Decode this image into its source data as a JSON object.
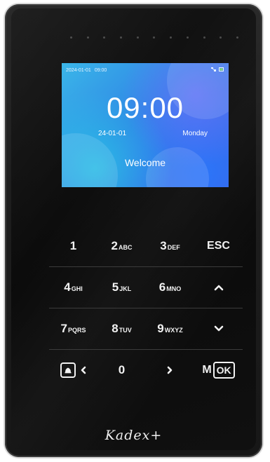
{
  "screen": {
    "status_date": "2024-01-01",
    "status_time": "09:00",
    "status_icons": [
      "network-icon",
      "battery-icon"
    ],
    "clock": "09:00",
    "date_short": "24-01-01",
    "weekday": "Monday",
    "welcome": "Welcome"
  },
  "keypad": {
    "row1": [
      {
        "digit": "1",
        "letters": ""
      },
      {
        "digit": "2",
        "letters": "ABC"
      },
      {
        "digit": "3",
        "letters": "DEF"
      },
      {
        "text": "ESC"
      }
    ],
    "row2": [
      {
        "digit": "4",
        "letters": "GHI"
      },
      {
        "digit": "5",
        "letters": "JKL"
      },
      {
        "digit": "6",
        "letters": "MNO"
      },
      {
        "icon": "chevron-up-icon"
      }
    ],
    "row3": [
      {
        "digit": "7",
        "letters": "PQRS"
      },
      {
        "digit": "8",
        "letters": "TUV"
      },
      {
        "digit": "9",
        "letters": "WXYZ"
      },
      {
        "icon": "chevron-down-icon"
      }
    ],
    "row4": {
      "bell_icon": "doorbell-icon",
      "left_icon": "chevron-left-icon",
      "zero": "0",
      "right_icon": "chevron-right-icon",
      "menu": "M",
      "ok": "OK"
    }
  },
  "brand": {
    "name": "Kadex+"
  },
  "colors": {
    "body": "#1a1a1a",
    "screen_accent": "#2f86e6",
    "key_text": "#f2f2f2"
  }
}
